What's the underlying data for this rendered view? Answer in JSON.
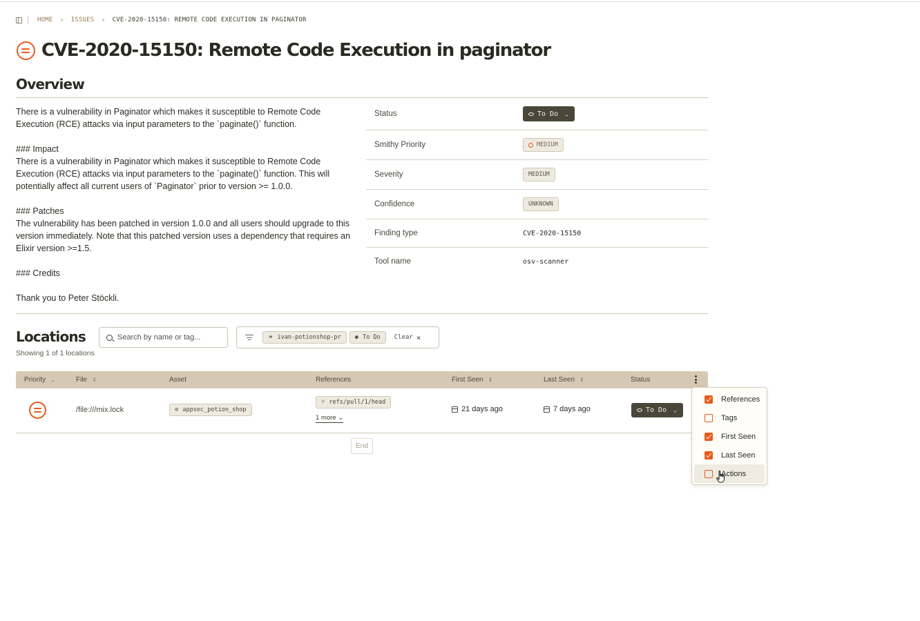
{
  "breadcrumb": {
    "home": "HOME",
    "issues": "ISSUES",
    "current": "CVE-2020-15150: REMOTE CODE EXECUTION IN PAGINATOR"
  },
  "page": {
    "title": "CVE-2020-15150: Remote Code Execution in paginator",
    "priority_icon": "priority-medium-icon"
  },
  "overview": {
    "heading": "Overview",
    "description": [
      "There is a vulnerability in Paginator which makes it susceptible to Remote Code Execution (RCE) attacks via input parameters to the `paginate()` function.",
      "### Impact\nThere is a vulnerability in Paginator which makes it susceptible to Remote Code Execution (RCE) attacks via input parameters to the `paginate()` function. This will potentially affect all current users of `Paginator` prior to version >= 1.0.0.",
      "### Patches\nThe vulnerability has been patched in version 1.0.0 and all users should upgrade to this version immediately. Note that this patched version uses a dependency that requires an Elixir version >=1.5.",
      "### Credits",
      "Thank you to Peter Stöckli."
    ],
    "properties": {
      "status_label": "Status",
      "status_value": "To Do",
      "smithy_priority_label": "Smithy Priority",
      "smithy_priority_value": "MEDIUM",
      "severity_label": "Severity",
      "severity_value": "MEDIUM",
      "confidence_label": "Confidence",
      "confidence_value": "UNKNOWN",
      "finding_type_label": "Finding type",
      "finding_type_value": "CVE-2020-15150",
      "tool_name_label": "Tool name",
      "tool_name_value": "osv-scanner"
    }
  },
  "locations": {
    "heading": "Locations",
    "search_placeholder": "Search by name or tag...",
    "filters": {
      "repo_chip": "ivan-potionshop-pr",
      "status_chip": "To Do",
      "clear_label": "Clear"
    },
    "showing": "Showing 1 of 1 locations",
    "columns": {
      "priority": "Priority",
      "file": "File",
      "asset": "Asset",
      "references": "References",
      "first_seen": "First Seen",
      "last_seen": "Last Seen",
      "status": "Status"
    },
    "rows": [
      {
        "file": "/file:///mix.lock",
        "asset": "appsec_potion_shop",
        "reference": "refs/pull/1/head",
        "more": "1 more",
        "first_seen": "21 days ago",
        "last_seen": "7 days ago",
        "status": "To Do"
      }
    ],
    "end_label": "End"
  },
  "column_menu": {
    "items": [
      {
        "label": "References",
        "checked": true
      },
      {
        "label": "Tags",
        "checked": false
      },
      {
        "label": "First Seen",
        "checked": true
      },
      {
        "label": "Last Seen",
        "checked": true
      },
      {
        "label": "Actions",
        "checked": false
      }
    ]
  },
  "colors": {
    "accent": "#e85a1c",
    "header_bg": "#d6c9b4",
    "status_bg": "#4a463a"
  }
}
